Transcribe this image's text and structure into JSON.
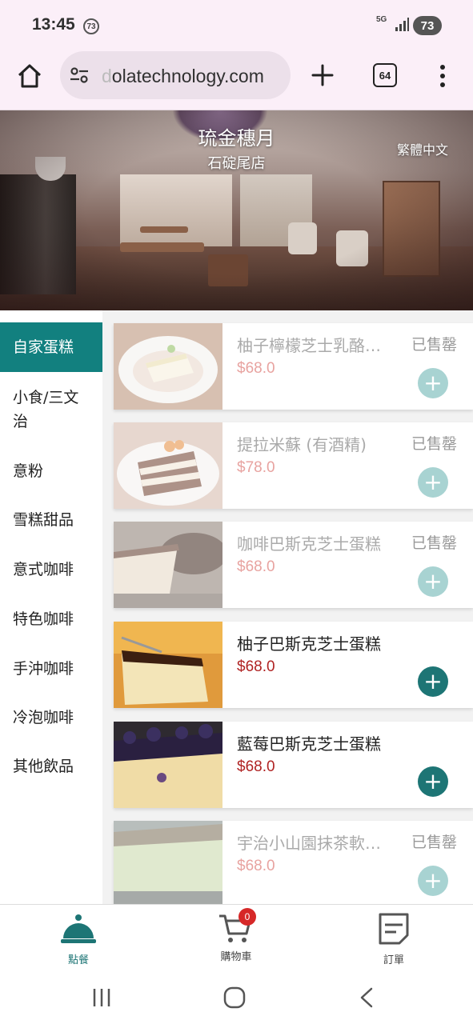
{
  "status_bar": {
    "time": "13:45",
    "notification_count": "73",
    "network": "5G",
    "battery": "73"
  },
  "browser": {
    "url_faded": "d",
    "url": "olatechnology.com",
    "tab_count": "64"
  },
  "banner": {
    "title": "琉金穗月",
    "subtitle": "石碇尾店",
    "language": "繁體中文"
  },
  "categories": [
    {
      "label": "自家蛋糕",
      "active": true
    },
    {
      "label": "小食/三文治"
    },
    {
      "label": "意粉"
    },
    {
      "label": "雪糕甜品"
    },
    {
      "label": "意式咖啡"
    },
    {
      "label": "特色咖啡"
    },
    {
      "label": "手沖咖啡"
    },
    {
      "label": "冷泡咖啡"
    },
    {
      "label": "其他飲品"
    }
  ],
  "products": [
    {
      "name": "柚子檸檬芝士乳酪…",
      "price": "$68.0",
      "status": "已售罄"
    },
    {
      "name": "提拉米蘇 (有酒精)",
      "price": "$78.0",
      "status": "已售罄"
    },
    {
      "name": "咖啡巴斯克芝士蛋糕",
      "price": "$68.0",
      "status": "已售罄"
    },
    {
      "name": "柚子巴斯克芝士蛋糕",
      "price": "$68.0",
      "status": ""
    },
    {
      "name": "藍莓巴斯克芝士蛋糕",
      "price": "$68.0",
      "status": ""
    },
    {
      "name": "宇治小山園抹茶軟…",
      "price": "$68.0",
      "status": "已售罄"
    }
  ],
  "add_symbol": "+",
  "bottom_nav": {
    "order": "點餐",
    "cart": "購物車",
    "cart_count": "0",
    "orders": "訂單"
  },
  "colors": {
    "accent": "#12807f",
    "price": "#b02323",
    "badge": "#d62828"
  }
}
